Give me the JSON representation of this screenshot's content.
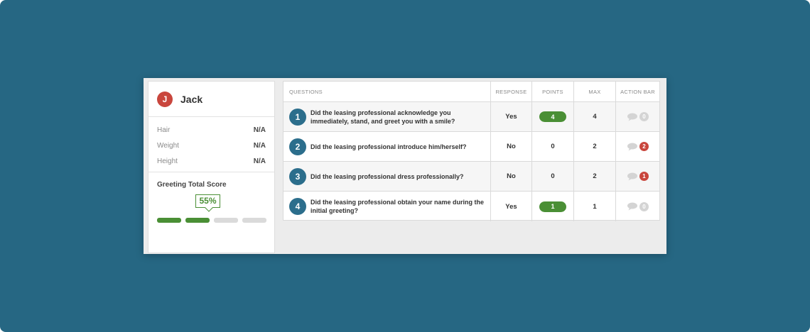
{
  "profile": {
    "initial": "J",
    "name": "Jack",
    "attributes": [
      {
        "label": "Hair",
        "value": "N/A"
      },
      {
        "label": "Weight",
        "value": "N/A"
      },
      {
        "label": "Height",
        "value": "N/A"
      }
    ]
  },
  "score": {
    "title": "Greeting Total Score",
    "percent_label": "55%",
    "segments_filled": 2,
    "segments_total": 4
  },
  "table": {
    "headers": {
      "questions": "QUESTIONS",
      "response": "RESPONSE",
      "points": "POINTS",
      "max": "MAX",
      "action": "ACTION BAR"
    },
    "rows": [
      {
        "num": "1",
        "question": "Did the leasing professional acknowledge you immediately, stand, and greet you with a smile?",
        "response": "Yes",
        "points": "4",
        "points_style": "pill",
        "max": "4",
        "comments": "0",
        "comments_style": "zero"
      },
      {
        "num": "2",
        "question": "Did the leasing professional introduce him/herself?",
        "response": "No",
        "points": "0",
        "points_style": "plain",
        "max": "2",
        "comments": "2",
        "comments_style": "alert"
      },
      {
        "num": "3",
        "question": "Did the leasing professional dress professionally?",
        "response": "No",
        "points": "0",
        "points_style": "plain",
        "max": "2",
        "comments": "1",
        "comments_style": "alert"
      },
      {
        "num": "4",
        "question": "Did the leasing professional obtain your name during the initial greeting?",
        "response": "Yes",
        "points": "1",
        "points_style": "pill",
        "max": "1",
        "comments": "0",
        "comments_style": "zero"
      }
    ]
  },
  "colors": {
    "background": "#266783",
    "accent_green": "#4a8f35",
    "alert_red": "#c9463d",
    "number_blue": "#2c6e8c"
  },
  "icons": {
    "comment": "speech-bubble-icon"
  }
}
